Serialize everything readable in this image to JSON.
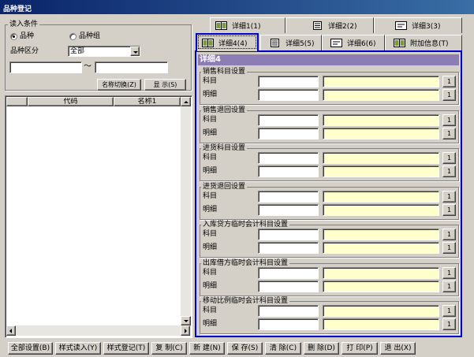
{
  "window": {
    "title": "品种登记"
  },
  "read_conditions": {
    "group_label": "读入条件",
    "radio_item": "品种",
    "radio_group": "品种组",
    "category_label": "品种区分",
    "category_value": "全部",
    "range_from": "",
    "range_to": "",
    "tilde": "～",
    "name_toggle_button": "名称切换(Z)",
    "display_button": "显 示(S)"
  },
  "grid": {
    "columns": [
      "代码",
      "名称1"
    ]
  },
  "tabs_row1": [
    {
      "label": "详细1(1)"
    },
    {
      "label": "详细2(2)"
    },
    {
      "label": "详细3(3)"
    }
  ],
  "tabs_row2": [
    {
      "label": "详细4(4)",
      "active": true
    },
    {
      "label": "详细5(5)"
    },
    {
      "label": "详细6(6)"
    },
    {
      "label": "附加信息(T)"
    }
  ],
  "panel": {
    "header": "详细4",
    "row_subject": "科目",
    "row_detail": "明细",
    "lookup_button": "1",
    "groups": [
      {
        "title": "销售科目设置"
      },
      {
        "title": "销售退回设置"
      },
      {
        "title": "进货科目设置"
      },
      {
        "title": "进货退回设置"
      },
      {
        "title": "入库贷方临时会计科目设置"
      },
      {
        "title": "出库借方临时会计科目设置"
      },
      {
        "title": "移动比例临时会计科目设置"
      }
    ]
  },
  "bottom_buttons": [
    "全部设置(B)",
    "样式读入(Y)",
    "样式登记(T)",
    "复 制(C)",
    "新 建(N)",
    "保 存(S)",
    "清 除(C)",
    "删 除(D)",
    "打 印(P)",
    "退 出(X)"
  ],
  "colors": {
    "panel_header": "#8c7eb4",
    "active_border": "#0000cc",
    "field_yellow": "#ffffcc"
  }
}
